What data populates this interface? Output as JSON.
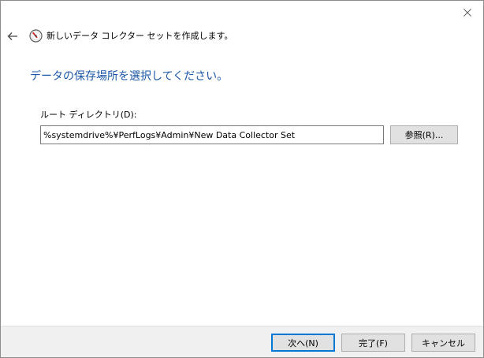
{
  "wizard": {
    "title": "新しいデータ コレクター セットを作成します。",
    "back_icon": "arrow-left-icon",
    "app_icon": "performance-gauge-icon",
    "close_icon": "close-icon"
  },
  "page": {
    "heading": "データの保存場所を選択してください。"
  },
  "root_directory": {
    "label": "ルート ディレクトリ(D):",
    "value": "%systemdrive%¥PerfLogs¥Admin¥New Data Collector Set",
    "browse_label": "参照(R)..."
  },
  "footer": {
    "next_label": "次へ(N)",
    "finish_label": "完了(F)",
    "cancel_label": "キャンセル"
  },
  "colors": {
    "heading": "#1a56a6",
    "footer_bg": "#f0f0f0",
    "default_button_border": "#0078d7"
  }
}
